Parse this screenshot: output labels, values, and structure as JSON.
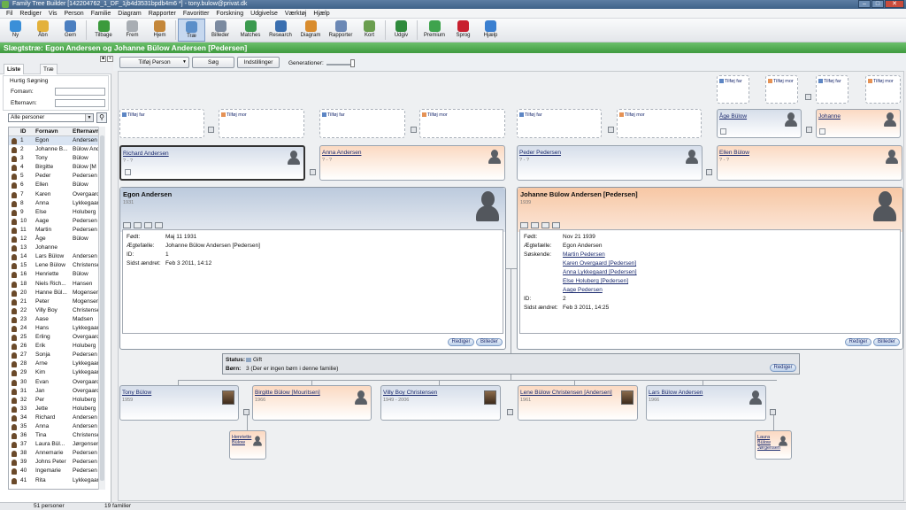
{
  "window": {
    "title": "Family Tree Builder [142204762_1_DF_1jb4d3531bpdb4m6 *] - tony.bulow@privat.dk"
  },
  "menu": [
    "Fil",
    "Rediger",
    "Vis",
    "Person",
    "Familie",
    "Diagram",
    "Rapporter",
    "Favoritter",
    "Forskning",
    "Udgivelse",
    "Værktøj",
    "Hjælp"
  ],
  "toolbar": [
    {
      "label": "Ny",
      "icon": "new-icon",
      "color": "#3a8fd8"
    },
    {
      "label": "Åbn",
      "icon": "open-folder-icon",
      "color": "#e3b13b"
    },
    {
      "label": "Gem",
      "icon": "save-icon",
      "color": "#4b7fc0"
    },
    {
      "label": "Tilbage",
      "icon": "back-arrow-icon",
      "color": "#3c9a3c"
    },
    {
      "label": "Frem",
      "icon": "forward-arrow-icon",
      "color": "#a8adb3"
    },
    {
      "label": "Hjem",
      "icon": "home-icon",
      "color": "#c4873a"
    },
    {
      "label": "Træ",
      "icon": "tree-icon",
      "color": "#5b8fc9"
    },
    {
      "label": "Billeder",
      "icon": "pictures-icon",
      "color": "#7b8aa0"
    },
    {
      "label": "Matches",
      "icon": "matches-icon",
      "color": "#3b9a4f"
    },
    {
      "label": "Research",
      "icon": "research-icon",
      "color": "#3a6fb0"
    },
    {
      "label": "Diagram",
      "icon": "chart-icon",
      "color": "#d98c2e"
    },
    {
      "label": "Rapporter",
      "icon": "reports-icon",
      "color": "#6b88b5"
    },
    {
      "label": "Kort",
      "icon": "map-icon",
      "color": "#6a9e4f"
    },
    {
      "label": "Udgiv",
      "icon": "publish-icon",
      "color": "#2f8a3c"
    },
    {
      "label": "Premium",
      "icon": "premium-icon",
      "color": "#3fa34d"
    },
    {
      "label": "Sprog",
      "icon": "language-flag-icon",
      "color": "#c8202f"
    },
    {
      "label": "Hjælp",
      "icon": "help-icon",
      "color": "#3a7fd0"
    }
  ],
  "page_header": "Slægtstræ: Egon Andersen og Johanne Bülow Andersen [Pedersen]",
  "left_panel": {
    "tabs": [
      "Liste",
      "Træ"
    ],
    "quick_search": {
      "title": "Hurtig Søgning",
      "first_name_label": "Fornavn:",
      "last_name_label": "Efternavn:"
    },
    "filter_value": "Alle personer",
    "columns": [
      "ID",
      "Fornavn",
      "Efternavn"
    ],
    "rows": [
      [
        "1",
        "Egon",
        "Andersen"
      ],
      [
        "2",
        "Johanne B...",
        "Bülow And"
      ],
      [
        "3",
        "Tony",
        "Bülow"
      ],
      [
        "4",
        "Birgitte",
        "Bülow [M"
      ],
      [
        "5",
        "Peder",
        "Pedersen"
      ],
      [
        "6",
        "Ellen",
        "Bülow"
      ],
      [
        "7",
        "Karen",
        "Overgaard"
      ],
      [
        "8",
        "Anna",
        "Lykkegaard"
      ],
      [
        "9",
        "Else",
        "Holuberg"
      ],
      [
        "10",
        "Aage",
        "Pedersen"
      ],
      [
        "11",
        "Martin",
        "Pedersen"
      ],
      [
        "12",
        "Åge",
        "Bülow"
      ],
      [
        "13",
        "Johanne",
        ""
      ],
      [
        "14",
        "Lars Bülow",
        "Andersen"
      ],
      [
        "15",
        "Lene Bülow",
        "Christensen"
      ],
      [
        "16",
        "Henriette",
        "Bülow"
      ],
      [
        "18",
        "Niels Rich...",
        "Hansen"
      ],
      [
        "20",
        "Hanne Bül...",
        "Mogensen"
      ],
      [
        "21",
        "Peter",
        "Mogensen"
      ],
      [
        "22",
        "Villy Boy",
        "Christensen"
      ],
      [
        "23",
        "Aase",
        "Madsen"
      ],
      [
        "24",
        "Hans",
        "Lykkegaard"
      ],
      [
        "25",
        "Erling",
        "Overgaard"
      ],
      [
        "26",
        "Erik",
        "Holuberg"
      ],
      [
        "27",
        "Sonja",
        "Pedersen"
      ],
      [
        "28",
        "Arne",
        "Lykkegaard"
      ],
      [
        "29",
        "Kim",
        "Lykkegaard"
      ],
      [
        "30",
        "Evan",
        "Overgaard"
      ],
      [
        "31",
        "Jan",
        "Overgaard"
      ],
      [
        "32",
        "Per",
        "Holuberg"
      ],
      [
        "33",
        "Jette",
        "Holuberg"
      ],
      [
        "34",
        "Richard",
        "Andersen"
      ],
      [
        "35",
        "Anna",
        "Andersen"
      ],
      [
        "36",
        "Tina",
        "Christensen"
      ],
      [
        "37",
        "Laura Bül...",
        "Jørgensen"
      ],
      [
        "38",
        "Annemarie",
        "Pedersen"
      ],
      [
        "39",
        "Johns Peter",
        "Pedersen"
      ],
      [
        "40",
        "Ingemarie",
        "Pedersen"
      ],
      [
        "41",
        "Rita",
        "Lykkegaard"
      ]
    ]
  },
  "statusbar": {
    "persons": "51 personer",
    "families": "19 familier"
  },
  "tree_tools": {
    "add_person": "Tilføj Person",
    "search": "Søg",
    "settings": "Indstillinger",
    "generations_label": "Generationer:"
  },
  "tree": {
    "add_father": "Tilføj far",
    "add_mother": "Tilføj mor",
    "unknown_dates": "? - ?",
    "grandparents": [
      {
        "name": "Richard Andersen",
        "dates": "? - ?"
      },
      {
        "name": "Anna Andersen",
        "dates": "? - ?"
      },
      {
        "name": "Peder Pedersen",
        "dates": "? - ?"
      },
      {
        "name": "Ellen Bülow",
        "dates": "? - ?"
      }
    ],
    "great_grandparents": [
      {
        "name": "Åge Bülow"
      },
      {
        "name": "Johanne"
      }
    ],
    "husband": {
      "name": "Egon Andersen",
      "year": "1931",
      "rows": [
        {
          "label": "Født:",
          "value": "Maj 11 1931"
        },
        {
          "label": "Ægtefælle:",
          "value": "Johanne Bülow Andersen [Pedersen]"
        },
        {
          "label": "ID:",
          "value": "1"
        },
        {
          "label": "Sidst ændret:",
          "value": "Feb 3 2011, 14:12"
        }
      ]
    },
    "wife": {
      "name": "Johanne Bülow Andersen [Pedersen]",
      "year": "1939",
      "born_label": "Født:",
      "born": "Nov 21 1939",
      "spouse_label": "Ægtefælle:",
      "spouse": "Egon Andersen",
      "siblings_label": "Søskende:",
      "siblings": [
        "Martin Pedersen",
        "Karen Overgaard [Pedersen]",
        "Anna Lykkegaard [Pedersen]",
        "Else Holuberg [Pedersen]",
        "Aage Pedersen"
      ],
      "id_label": "ID:",
      "id": "2",
      "changed_label": "Sidst ændret:",
      "changed": "Feb 3 2011, 14:25"
    },
    "edit_btn": "Rediger",
    "more_btn": "Billeder",
    "family": {
      "status_label": "Status:",
      "status": "Gift",
      "children_label": "Børn:",
      "children_text": "3 (Der er ingen børn i denne familie)",
      "edit": "Rediger"
    },
    "children": [
      {
        "name": "Tony Bülow",
        "dates": "1959"
      },
      {
        "name": "Birgitte Bülow [Mouritsen]",
        "dates": "1966"
      },
      {
        "name": "Villy Boy Christensen",
        "dates": "1949 - 2006"
      },
      {
        "name": "Lene Bülow Christensen [Andersen]",
        "dates": "1961"
      },
      {
        "name": "Lars Bülow Andersen",
        "dates": "1966"
      }
    ],
    "grandchildren": [
      {
        "name": "Henriette Bülow"
      },
      {
        "name": "Laura Bülow Jørgensen"
      }
    ]
  }
}
